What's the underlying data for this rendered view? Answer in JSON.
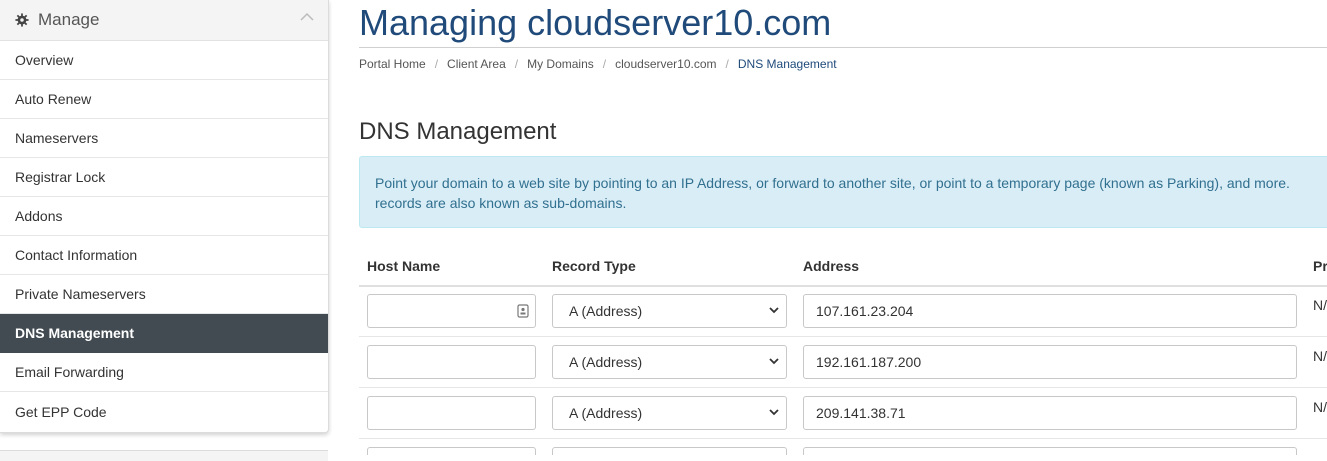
{
  "sidebar": {
    "title": "Manage",
    "items": [
      {
        "label": "Overview"
      },
      {
        "label": "Auto Renew"
      },
      {
        "label": "Nameservers"
      },
      {
        "label": "Registrar Lock"
      },
      {
        "label": "Addons"
      },
      {
        "label": "Contact Information"
      },
      {
        "label": "Private Nameservers"
      },
      {
        "label": "DNS Management",
        "active": true
      },
      {
        "label": "Email Forwarding"
      },
      {
        "label": "Get EPP Code"
      }
    ]
  },
  "header": {
    "title": "Managing cloudserver10.com",
    "breadcrumb": [
      "Portal Home",
      "Client Area",
      "My Domains",
      "cloudserver10.com",
      "DNS Management"
    ]
  },
  "main": {
    "section_title": "DNS Management",
    "info_line1": "Point your domain to a web site by pointing to an IP Address, or forward to another site, or point to a temporary page (known as Parking), and more.",
    "info_line2": "records are also known as sub-domains.",
    "table": {
      "headers": [
        "Host Name",
        "Record Type",
        "Address",
        "Pr"
      ],
      "rows": [
        {
          "host": "",
          "type": "A (Address)",
          "address": "107.161.23.204",
          "priority": "N/A"
        },
        {
          "host": "",
          "type": "A (Address)",
          "address": "192.161.187.200",
          "priority": "N/A"
        },
        {
          "host": "",
          "type": "A (Address)",
          "address": "209.141.38.71",
          "priority": "N/A"
        }
      ]
    }
  },
  "colors": {
    "title_blue": "#1f4a7a",
    "active_bg": "#424b52",
    "info_bg": "#d9edf7",
    "info_text": "#31708f"
  }
}
